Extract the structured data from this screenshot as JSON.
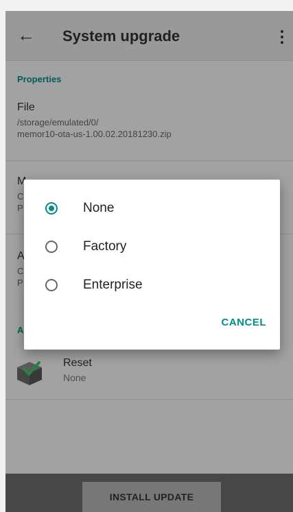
{
  "app_bar": {
    "title": "System upgrade",
    "back_icon": "arrow-left-icon",
    "menu_icon": "more-vert-icon"
  },
  "properties": {
    "header": "Properties",
    "file": {
      "title": "File",
      "path_line1": "/storage/emulated/0/",
      "path_line2": "memor10-ota-us-1.00.02.20181230.zip"
    },
    "partial_item_1": {
      "title_start": "M",
      "line1_start": "C",
      "line2_start": "P"
    },
    "partial_item_2": {
      "title_start": "A",
      "line1_start": "C",
      "line2_start": "P"
    }
  },
  "section2": {
    "header_start": "A"
  },
  "reset": {
    "title": "Reset",
    "summary": "None",
    "icon": "reset-box-icon"
  },
  "bottom": {
    "install_label": "INSTALL UPDATE"
  },
  "dialog": {
    "options": [
      {
        "label": "None",
        "checked": true
      },
      {
        "label": "Factory",
        "checked": false
      },
      {
        "label": "Enterprise",
        "checked": false
      }
    ],
    "cancel_label": "CANCEL"
  },
  "colors": {
    "accent": "#008e87"
  }
}
